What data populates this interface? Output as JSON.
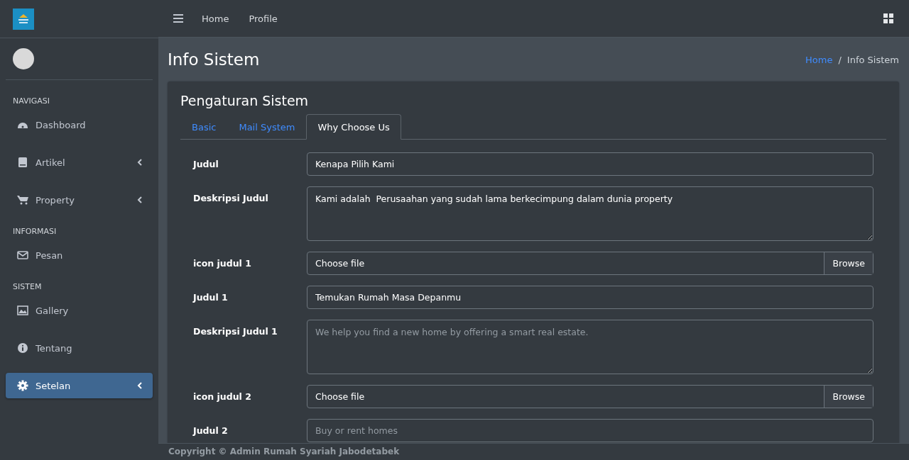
{
  "navbar": {
    "links": [
      "Home",
      "Profile"
    ]
  },
  "sidebar": {
    "sections": [
      {
        "kind": "item",
        "label": "Dashboard",
        "caret": false,
        "selected": false
      },
      {
        "kind": "item",
        "label": "Artikel",
        "caret": true,
        "selected": false
      },
      {
        "kind": "item",
        "label": "Property",
        "caret": true,
        "selected": false
      },
      {
        "kind": "header",
        "label": "INFORMASI"
      },
      {
        "kind": "item",
        "label": "Pesan",
        "caret": false,
        "selected": false
      },
      {
        "kind": "header",
        "label": "SISTEM"
      },
      {
        "kind": "item",
        "label": "Gallery",
        "caret": false,
        "selected": false
      },
      {
        "kind": "item",
        "label": "Tentang",
        "caret": false,
        "selected": false
      },
      {
        "kind": "item",
        "label": "Setelan",
        "caret": true,
        "selected": true
      }
    ],
    "title": "NAVIGASI"
  },
  "page": {
    "title": "Info Sistem",
    "breadcrumb": [
      "Home",
      "Info Sistem"
    ],
    "separator": "/"
  },
  "card": {
    "title": "Pengaturan Sistem",
    "tabs": [
      {
        "label": "Basic",
        "selected": false
      },
      {
        "label": "Mail System",
        "selected": false
      },
      {
        "label": "Why Choose Us",
        "selected": true
      }
    ],
    "fields": [
      {
        "kind": "text",
        "label": "Judul",
        "value": "Kenapa Pilih Kami"
      },
      {
        "kind": "textarea",
        "label": "Deskripsi Judul",
        "value": "Kami adalah  Perusaahan yang sudah lama berkecimpung dalam dunia property"
      },
      {
        "kind": "file",
        "label": "icon judul 1",
        "value": "Choose file",
        "button": "Browse"
      },
      {
        "kind": "text",
        "label": "Judul 1",
        "value": "Temukan Rumah Masa Depanmu"
      },
      {
        "kind": "textarea",
        "label": "Deskripsi Judul 1",
        "placeholder": "We help you find a new home by offering a smart real estate."
      },
      {
        "kind": "file",
        "label": "icon judul 2",
        "value": "Choose file",
        "button": "Browse"
      },
      {
        "kind": "text",
        "label": "Judul 2",
        "placeholder": "Buy or rent homes"
      }
    ]
  },
  "footer": "Copyright © Admin Rumah Syariah Jabodetabek"
}
